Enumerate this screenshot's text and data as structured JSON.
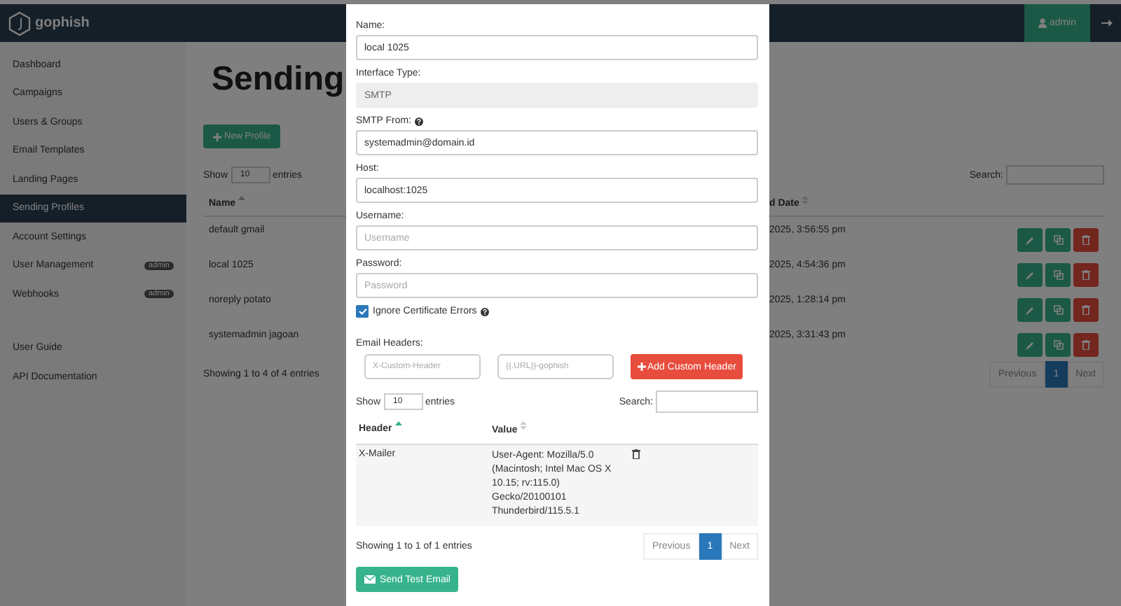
{
  "header": {
    "brand": "gophish",
    "user_button": "admin"
  },
  "sidebar": {
    "items": [
      {
        "label": "Dashboard",
        "selected": false
      },
      {
        "label": "Campaigns",
        "selected": false
      },
      {
        "label": "Users & Groups",
        "selected": false
      },
      {
        "label": "Email Templates",
        "selected": false
      },
      {
        "label": "Landing Pages",
        "selected": false
      },
      {
        "label": "Sending Profiles",
        "selected": true
      },
      {
        "label": "Account Settings",
        "selected": false
      },
      {
        "label": "User Management",
        "selected": false,
        "badge": "admin"
      },
      {
        "label": "Webhooks",
        "selected": false,
        "badge": "admin"
      }
    ],
    "links": [
      "User Guide",
      "API Documentation"
    ]
  },
  "page": {
    "title": "Sending",
    "new_button": "New Profile",
    "show_label": "Show",
    "page_length": "10",
    "entries_label": "entries",
    "search_label": "Search:",
    "columns": [
      "Name",
      "d Date"
    ],
    "rows": [
      {
        "name": "default gmail",
        "date": "2025, 3:56:55 pm"
      },
      {
        "name": "local 1025",
        "date": "2025, 4:54:36 pm"
      },
      {
        "name": "noreply potato",
        "date": "2025, 1:28:14 pm"
      },
      {
        "name": "systemadmin jagoan",
        "date": "2025, 3:31:43 pm"
      }
    ],
    "info": "Showing 1 to 4 of 4 entries",
    "pagination": {
      "previous": "Previous",
      "pages": [
        {
          "label": "1",
          "selected": true
        }
      ],
      "next": "Next"
    }
  },
  "modal": {
    "fields": [
      {
        "label": "Name:",
        "value": "local 1025",
        "help": false,
        "disabled": false
      },
      {
        "label": "Interface Type:",
        "value": "SMTP",
        "help": false,
        "disabled": true
      },
      {
        "label": "SMTP From:",
        "value": "systemadmin@domain.id",
        "help": true,
        "disabled": false
      },
      {
        "label": "Host:",
        "value": "localhost:1025",
        "help": false,
        "disabled": false
      },
      {
        "label": "Username:",
        "placeholder": "Username",
        "help": false,
        "disabled": false
      },
      {
        "label": "Password:",
        "placeholder": "Password",
        "help": false,
        "disabled": false
      }
    ],
    "ignore_cert": {
      "label": "Ignore Certificate Errors",
      "checked": true,
      "help": true
    },
    "headers": {
      "label": "Email Headers:",
      "header_placeholder": "X-Custom-Header",
      "value_placeholder": "{{.URL}}-gophish",
      "add_button": "Add Custom Header",
      "show_label": "Show",
      "page_length": "10",
      "entries_label": "entries",
      "search_label": "Search:",
      "columns": [
        "Header",
        "Value"
      ],
      "rows": [
        {
          "header": "X-Mailer",
          "value": "User-Agent: Mozilla/5.0 (Macintosh; Intel Mac OS X 10.15; rv:115.0) Gecko/20100101 Thunderbird/115.5.1"
        }
      ],
      "info": "Showing 1 to 1 of 1 entries",
      "pagination": {
        "previous": "Previous",
        "pages": [
          {
            "label": "1",
            "selected": true
          }
        ],
        "next": "Next"
      }
    },
    "send_button": "Send Test Email"
  }
}
